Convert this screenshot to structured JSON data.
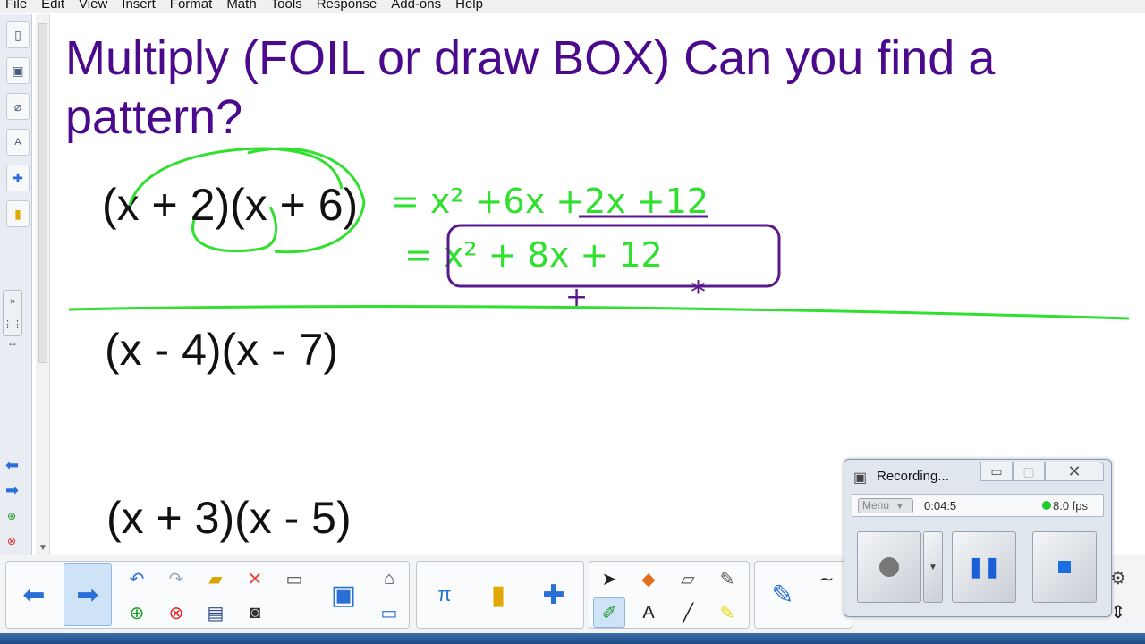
{
  "menu": [
    "File",
    "Edit",
    "View",
    "Insert",
    "Format",
    "Math",
    "Tools",
    "Response",
    "Add-ons",
    "Help"
  ],
  "page": {
    "title": "Multiply (FOIL or draw BOX)   Can you find a pattern?",
    "problems": [
      "(x + 2)(x + 6)",
      "(x - 4)(x - 7)",
      "(x + 3)(x - 5)"
    ],
    "handwriting": {
      "line1": "= x² +6x +2x +12",
      "line2": "= x² + 8x + 12",
      "marks": [
        "+",
        "*"
      ]
    }
  },
  "recording": {
    "title": "Recording...",
    "menu_label": "Menu",
    "elapsed": "0:04:5",
    "fps": "8.0 fps"
  },
  "colors": {
    "title_purple": "#4b0a8c",
    "ink_green": "#2fe02f",
    "ink_purple": "#5a1a8c",
    "accent_blue": "#2a6fd6"
  }
}
